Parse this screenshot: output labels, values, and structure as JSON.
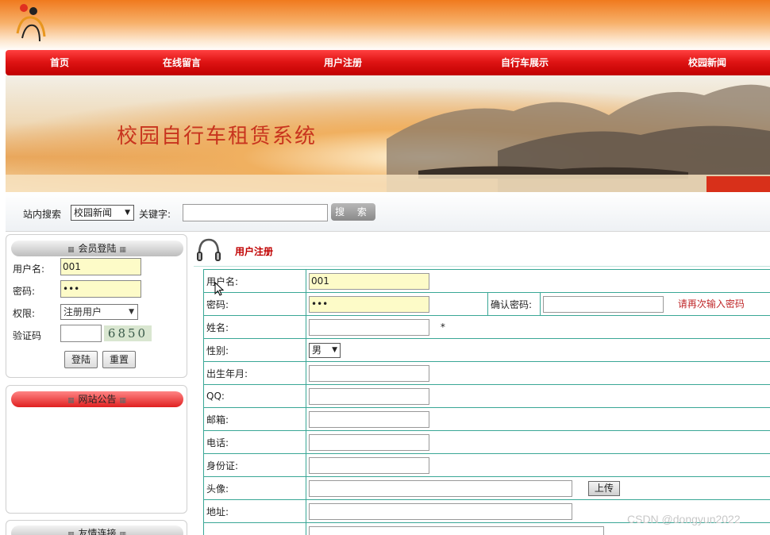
{
  "nav": {
    "items": [
      "首页",
      "在线留言",
      "用户注册",
      "自行车展示",
      "校园新闻"
    ]
  },
  "banner": {
    "title": "校园自行车租赁系统"
  },
  "search": {
    "site_search_label": "站内搜索",
    "category_selected": "校园新闻",
    "keyword_label": "关键字:",
    "keyword_value": "",
    "button_label": "搜 索"
  },
  "login": {
    "title": "会员登陆",
    "username_label": "用户名:",
    "username_value": "001",
    "password_label": "密码:",
    "password_value": "•••",
    "role_label": "权限:",
    "role_selected": "注册用户",
    "captcha_label": "验证码",
    "captcha_code": "6850",
    "login_button": "登陆",
    "reset_button": "重置"
  },
  "notice": {
    "title": "网站公告"
  },
  "third_panel": {
    "title": "友情连接"
  },
  "register": {
    "title": "用户注册",
    "rows": {
      "username": {
        "label": "用户名:",
        "value": "001"
      },
      "password": {
        "label": "密码:",
        "value": "•••"
      },
      "confirm": {
        "label": "确认密码:",
        "value": "",
        "hint": "请再次输入密码"
      },
      "name": {
        "label": "姓名:",
        "required": "*"
      },
      "gender": {
        "label": "性别:",
        "selected": "男"
      },
      "birth": {
        "label": "出生年月:"
      },
      "qq": {
        "label": "QQ:"
      },
      "email": {
        "label": "邮箱:"
      },
      "phone": {
        "label": "电话:"
      },
      "idcard": {
        "label": "身份证:"
      },
      "avatar": {
        "label": "头像:",
        "upload_label": "上传"
      },
      "address": {
        "label": "地址:"
      }
    }
  },
  "watermark": "CSDN @dongyun2022",
  "colors": {
    "nav_red": "#d81010",
    "accent_red": "#c00000",
    "table_border": "#3aa796",
    "filled_input": "#fdfbc8"
  }
}
